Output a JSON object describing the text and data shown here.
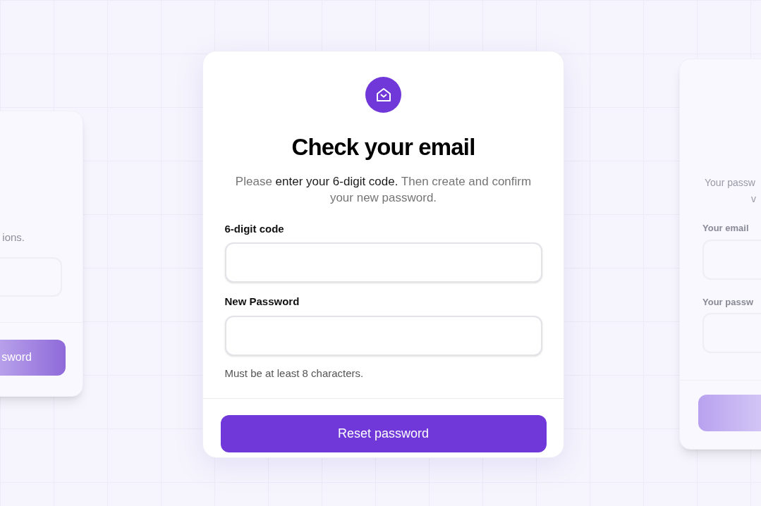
{
  "left_card": {
    "text": "ions.",
    "button": "sword"
  },
  "right_card": {
    "subtitle_lines": [
      "Your passw",
      "v"
    ],
    "fields": [
      {
        "label": "Your email"
      },
      {
        "label": "Your passw"
      }
    ]
  },
  "dialog": {
    "title": "Check your email",
    "subtitle": [
      {
        "text": "Please ",
        "emphasis": false
      },
      {
        "text": "enter your 6-digit code.",
        "emphasis": true
      },
      {
        "text": " Then create and confirm your new password.",
        "emphasis": false
      }
    ],
    "fields": [
      {
        "label": "6-digit code"
      },
      {
        "label": "New Password",
        "hint": "Must be at least 8 characters."
      }
    ],
    "button": "Reset password"
  }
}
